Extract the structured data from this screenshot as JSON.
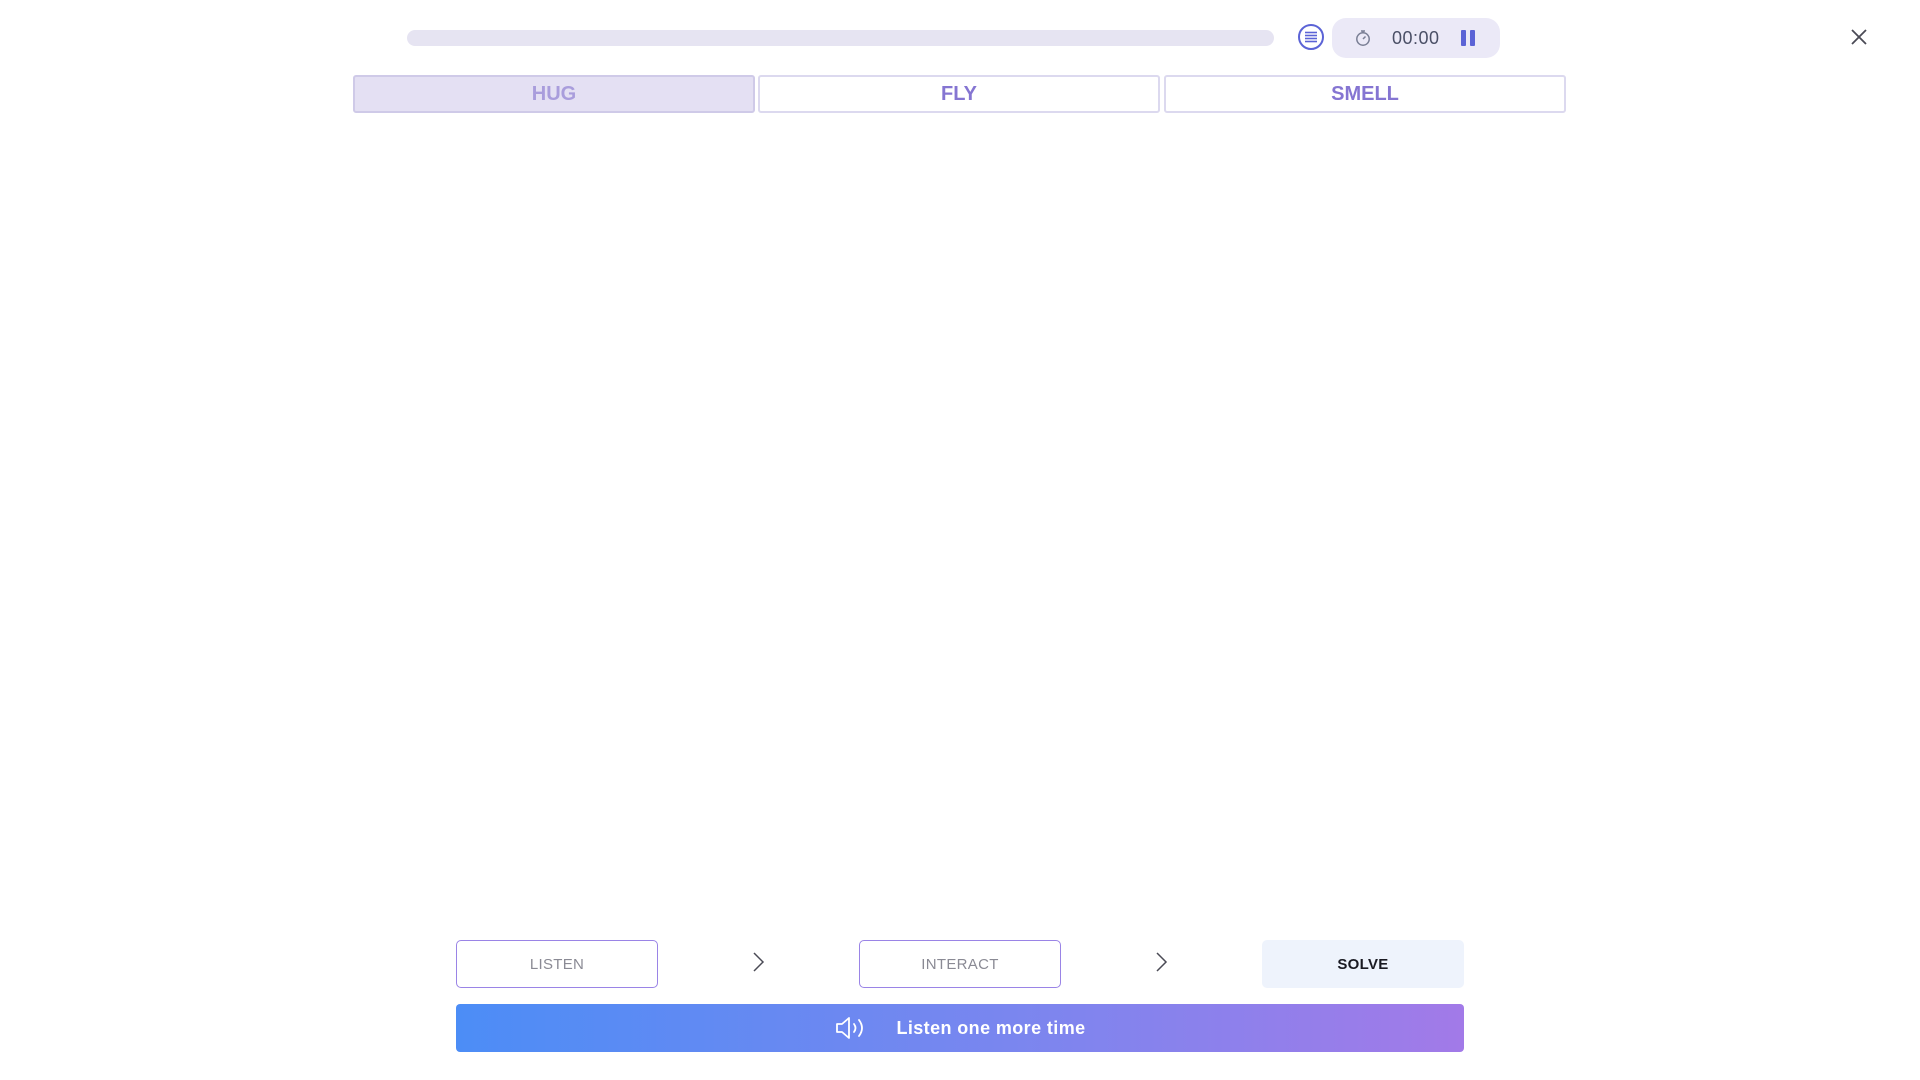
{
  "header": {
    "progress_fraction": 0,
    "timer": "00:00"
  },
  "word_tabs": [
    {
      "label": "HUG",
      "active": true
    },
    {
      "label": "FLY",
      "active": false
    },
    {
      "label": "SMELL",
      "active": false
    }
  ],
  "steps": {
    "listen": "LISTEN",
    "interact": "INTERACT",
    "solve": "SOLVE"
  },
  "listen_again_label": "Listen one more time",
  "colors": {
    "accent": "#5b63d6",
    "tab_text": "#8575d2",
    "gradient_start": "#4c8df6",
    "gradient_end": "#a27ae8"
  },
  "icons": {
    "list": "list-icon",
    "timer": "stopwatch-icon",
    "pause": "pause-icon",
    "close": "close-icon",
    "step_arrow": "chevron-right-icon",
    "speaker": "speaker-icon"
  }
}
